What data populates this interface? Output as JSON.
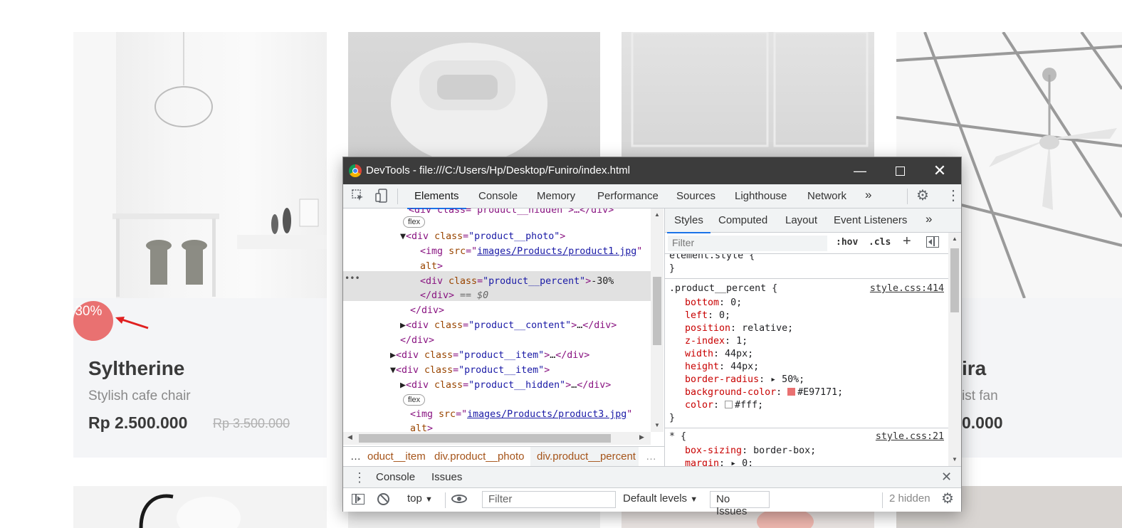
{
  "products": [
    {
      "name": "Syltherine",
      "desc": "Stylish cafe chair",
      "price": "Rp 2.500.000",
      "old_price": "Rp 3.500.000",
      "badge": "-30%"
    },
    {
      "name_fragment": "ira",
      "desc_fragment": "ist fan",
      "price_fragment": "0.000"
    }
  ],
  "devtools": {
    "title": "DevTools - file:///C:/Users/Hp/Desktop/Funiro/index.html",
    "tabs": [
      "Elements",
      "Console",
      "Memory",
      "Performance",
      "Sources",
      "Lighthouse",
      "Network",
      "»"
    ],
    "active_tab": "Elements",
    "dom": {
      "l0": "<div class=\"product__hidden\">…</div>",
      "flex": "flex",
      "photo_open_tag": "div",
      "photo_attr": "class",
      "photo_val": "\"product__photo\"",
      "img_tag": "img",
      "img_attr": "src",
      "img_src": "images/Products/product1.jpg",
      "alt": "alt",
      "percent_val": "\"product__percent\"",
      "percent_text": "-30%",
      "close_div": "</div>",
      "eq": " == $0",
      "content_val": "\"product__content\"",
      "ellipsis": "…",
      "item_val": "\"product__item\"",
      "hidden_val": "\"product__hidden\"",
      "img3_src": "images/Products/product3.jpg",
      "dots": "…"
    },
    "breadcrumbs": [
      "…",
      "oduct__item",
      "div.product__photo",
      "div.product__percent",
      "…"
    ],
    "styles_tabs": [
      "Styles",
      "Computed",
      "Layout",
      "Event Listeners",
      "»"
    ],
    "filter_placeholder": "Filter",
    "hov": ":hov",
    "cls": ".cls",
    "plus": "+",
    "rules": {
      "element_style": "element.style {",
      "close": "}",
      "selector": ".product__percent {",
      "source": "style.css:414",
      "props": [
        {
          "p": "bottom",
          "v": "0;"
        },
        {
          "p": "left",
          "v": "0;"
        },
        {
          "p": "position",
          "v": "relative;"
        },
        {
          "p": "z-index",
          "v": "1;"
        },
        {
          "p": "width",
          "v": "44px;"
        },
        {
          "p": "height",
          "v": "44px;"
        },
        {
          "p": "border-radius",
          "v": "▸ 50%;"
        },
        {
          "p": "background-color",
          "v": "#E97171;"
        },
        {
          "p": "color",
          "v": "#fff;"
        }
      ],
      "star_selector": "* {",
      "star_source": "style.css:21",
      "star_props": [
        {
          "p": "box-sizing",
          "v": "border-box;"
        },
        {
          "p": "margin",
          "v": "▸ 0;"
        }
      ]
    },
    "drawer_tabs": [
      "Console",
      "Issues"
    ],
    "console": {
      "context": "top",
      "filter_placeholder": "Filter",
      "levels": "Default levels",
      "issues": "No Issues",
      "hidden": "2 hidden"
    },
    "colors": {
      "badge": "#E97171",
      "accent": "#1a73e8",
      "titlebar": "#3c3c3c"
    },
    "icons": [
      "inspect-icon",
      "device-icon",
      "gear-icon",
      "kebab-icon",
      "close-icon",
      "minimize-icon",
      "maximize-icon",
      "sidebar-toggle-icon",
      "block-icon",
      "eye-icon"
    ]
  }
}
